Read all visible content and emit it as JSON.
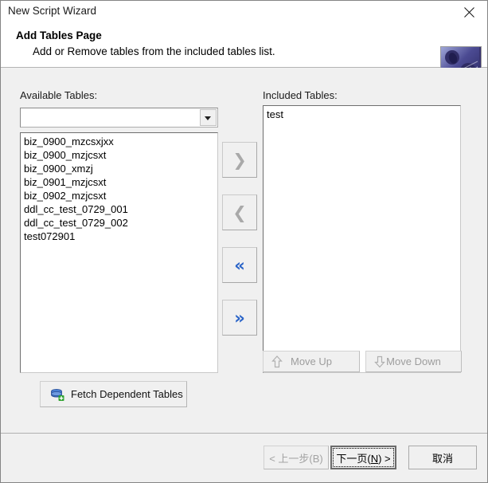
{
  "window": {
    "title": "New Script Wizard",
    "close_icon": "close-icon"
  },
  "header": {
    "title": "Add Tables Page",
    "subtitle": "Add or Remove tables from the included tables list.",
    "graphic": "gears-image"
  },
  "available": {
    "label": "Available Tables:",
    "combo": {
      "value": "",
      "arrow_icon": "chevron-down-icon"
    },
    "items": [
      "biz_0900_mzcsxjxx",
      "biz_0900_mzjcsxt",
      "biz_0900_xmzj",
      "biz_0901_mzjcsxt",
      "biz_0902_mzjcsxt",
      "ddl_cc_test_0729_001",
      "ddl_cc_test_0729_002",
      "test072901"
    ]
  },
  "included": {
    "label": "Included Tables:",
    "items": [
      "test"
    ]
  },
  "transfer_buttons": [
    {
      "name": "add-selected-button",
      "glyph": "❯",
      "icon": "chevron-right-icon",
      "enabled": false
    },
    {
      "name": "remove-selected-button",
      "glyph": "❮",
      "icon": "chevron-left-icon",
      "enabled": false
    },
    {
      "name": "remove-all-button",
      "glyph": "«",
      "icon": "double-chevron-left-icon",
      "enabled": true
    },
    {
      "name": "add-all-button",
      "glyph": "»",
      "icon": "double-chevron-right-icon",
      "enabled": true
    }
  ],
  "move": {
    "up_label": "Move Up",
    "down_label": "Move Down",
    "up_icon": "arrow-up-icon",
    "down_icon": "arrow-down-icon"
  },
  "fetch": {
    "label": "Fetch Dependent Tables",
    "icon": "tables-add-icon"
  },
  "footer": {
    "back_label": "< 上一步(B)",
    "next_prefix": "下一页(",
    "next_accel": "N",
    "next_suffix": ") >",
    "cancel_label": "取消"
  },
  "colors": {
    "dialog_bg": "#f0f0f0",
    "accent_blue": "#2a64c8",
    "disabled_gray": "#a9a9a9",
    "field_bg": "#ffffff"
  }
}
